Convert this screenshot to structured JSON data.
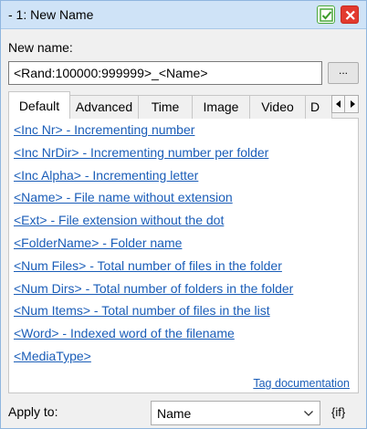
{
  "window": {
    "title": "-  1: New Name"
  },
  "new_name": {
    "label": "New name:",
    "value": "<Rand:100000:999999>_<Name>",
    "browse_label": "..."
  },
  "tabs": [
    {
      "label": "Default",
      "active": true
    },
    {
      "label": "Advanced",
      "active": false
    },
    {
      "label": "Time",
      "active": false
    },
    {
      "label": "Image",
      "active": false
    },
    {
      "label": "Video",
      "active": false
    },
    {
      "label": "D",
      "active": false
    }
  ],
  "tags": [
    "<Inc Nr> - Incrementing number",
    "<Inc NrDir> - Incrementing number per folder",
    "<Inc Alpha> - Incrementing letter",
    "<Name> - File name without extension",
    "<Ext> - File extension without the dot",
    "<FolderName> - Folder name",
    "<Num Files> - Total number of files in the folder",
    "<Num Dirs> - Total number of folders in the folder",
    "<Num Items> - Total number of files in the list",
    "<Word> - Indexed word of the filename",
    "<MediaType>"
  ],
  "tag_documentation": "Tag documentation",
  "apply_to": {
    "label": "Apply to:",
    "selected": "Name",
    "if_label": "{if}"
  },
  "colors": {
    "titlebar": "#cfe3f7",
    "link": "#1a5db8",
    "ok_green": "#4aa83a",
    "close_red": "#e23a2e"
  }
}
